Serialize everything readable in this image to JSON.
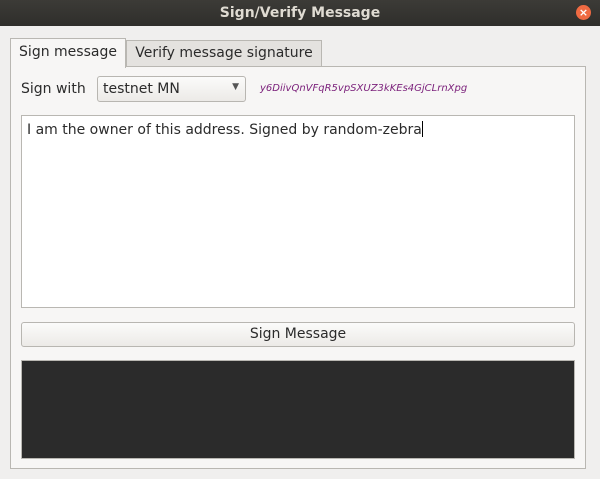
{
  "window": {
    "title": "Sign/Verify Message",
    "close_glyph": "×"
  },
  "tabs": [
    {
      "label": "Sign message",
      "active": true
    },
    {
      "label": "Verify message signature",
      "active": false
    }
  ],
  "sign": {
    "sign_with_label": "Sign with",
    "selected_account": "testnet MN",
    "combo_arrow": "▼",
    "address": "y6DiivQnVFqR5vpSXUZ3kKEs4GjCLrnXpg",
    "message": "I am the owner of this address. Signed by random-zebra",
    "sign_button_label": "Sign Message",
    "signature": ""
  },
  "colors": {
    "address": "#7a1f7a",
    "close_button": "#ef6a42",
    "signature_bg": "#2b2b2b"
  }
}
